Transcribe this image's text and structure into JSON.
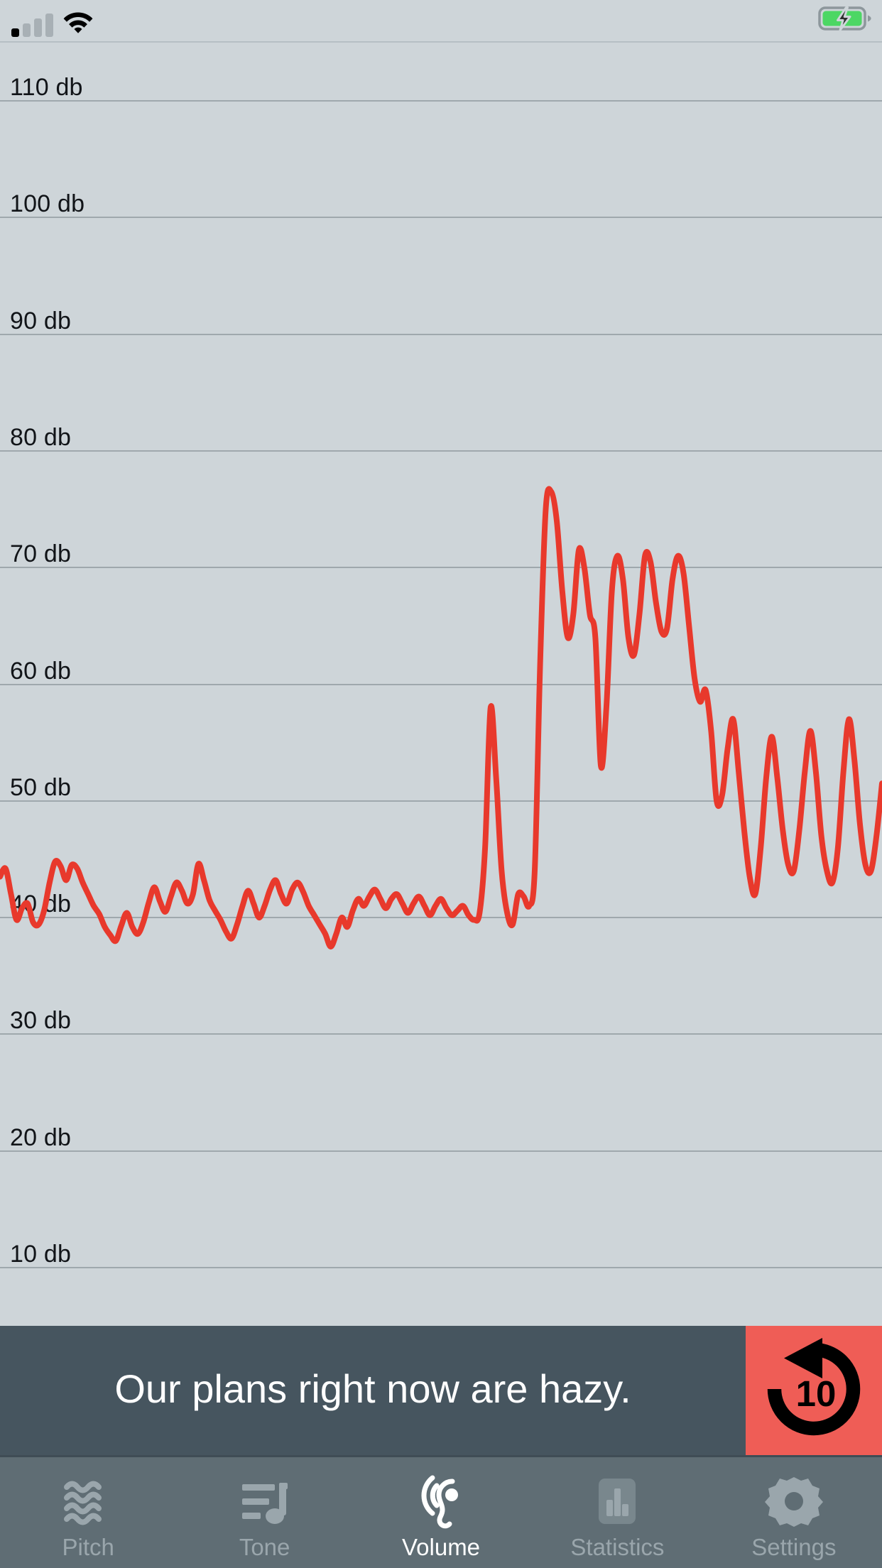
{
  "status_bar": {
    "signal_icon": "cellular-signal-icon",
    "signal_bars_filled": 1,
    "signal_bars_total": 4,
    "wifi_icon": "wifi-icon",
    "battery_icon": "battery-charging-icon",
    "battery_state": "charging"
  },
  "colors": {
    "background": "#ced5d9",
    "gridline": "#9fa8ad",
    "plot_line": "#e8392c",
    "caption_bar": "#46555f",
    "rewind_button": "#ef5d56",
    "tab_bar": "#5f6d74",
    "tab_inactive": "#9aa6ac",
    "tab_active": "#ffffff"
  },
  "chart_data": {
    "type": "line",
    "title": "",
    "xlabel": "",
    "ylabel": "",
    "unit": "db",
    "grid": true,
    "legend": "none",
    "ylim": [
      5,
      115
    ],
    "yticks": [
      110,
      100,
      90,
      80,
      70,
      60,
      50,
      40,
      30,
      20,
      10
    ],
    "ytick_labels": [
      "110 db",
      "100 db",
      "90 db",
      "80 db",
      "70 db",
      "60 db",
      "50 db",
      "40 db",
      "30 db",
      "20 db",
      "10 db"
    ],
    "xlim": [
      0,
      200
    ],
    "xticks": [],
    "xtick_labels": [],
    "series": [
      {
        "name": "Volume",
        "color": "#e8392c",
        "values": [
          43.5,
          44.2,
          42.0,
          39.8,
          40.8,
          41.2,
          39.6,
          39.4,
          40.6,
          43.0,
          44.8,
          44.4,
          43.2,
          44.5,
          44.2,
          43.0,
          42.0,
          41.0,
          40.3,
          39.2,
          38.5,
          38.0,
          39.3,
          40.4,
          39.2,
          38.6,
          39.6,
          41.3,
          42.6,
          41.4,
          40.5,
          41.8,
          43.0,
          42.3,
          41.2,
          42.0,
          44.6,
          43.2,
          41.5,
          40.6,
          39.8,
          38.8,
          38.2,
          39.4,
          41.0,
          42.3,
          41.2,
          40.0,
          41.0,
          42.4,
          43.2,
          42.0,
          41.2,
          42.4,
          43.0,
          42.2,
          41.0,
          40.2,
          39.4,
          38.6,
          37.5,
          38.6,
          40.0,
          39.2,
          40.6,
          41.6,
          41.0,
          41.8,
          42.4,
          41.6,
          40.8,
          41.6,
          42.0,
          41.2,
          40.4,
          41.2,
          41.8,
          41.0,
          40.2,
          41.0,
          41.6,
          40.8,
          40.2,
          40.6,
          41.0,
          40.2,
          39.8,
          40.4,
          46.0,
          58.0,
          52.0,
          44.0,
          40.4,
          39.4,
          42.0,
          41.8,
          41.0,
          44.0,
          62.0,
          75.0,
          76.5,
          74.0,
          68.0,
          64.0,
          66.0,
          71.5,
          70.0,
          66.0,
          64.0,
          53.0,
          58.0,
          68.0,
          71.0,
          69.0,
          64.0,
          62.5,
          66.0,
          71.0,
          70.5,
          67.0,
          64.5,
          64.8,
          69.0,
          71.0,
          69.5,
          65.0,
          60.5,
          58.5,
          59.5,
          56.0,
          50.0,
          50.5,
          54.5,
          57.0,
          52.5,
          47.5,
          43.5,
          42.0,
          46.0,
          52.0,
          55.5,
          52.0,
          47.5,
          44.5,
          44.0,
          47.5,
          52.5,
          56.0,
          52.5,
          47.0,
          44.0,
          43.0,
          46.0,
          52.5,
          57.0,
          53.5,
          48.0,
          44.5,
          44.0,
          47.0,
          51.5
        ]
      }
    ]
  },
  "caption": {
    "text": "Our plans right now are hazy."
  },
  "rewind_button": {
    "icon": "rewind-10-icon",
    "seconds": "10",
    "label": "10"
  },
  "tab_bar": {
    "active_index": 2,
    "items": [
      {
        "label": "Pitch",
        "icon": "waves-icon",
        "active": false
      },
      {
        "label": "Tone",
        "icon": "music-note-lines-icon",
        "active": false
      },
      {
        "label": "Volume",
        "icon": "ear-sound-icon",
        "active": true
      },
      {
        "label": "Statistics",
        "icon": "bar-chart-icon",
        "active": false
      },
      {
        "label": "Settings",
        "icon": "gear-icon",
        "active": false
      }
    ]
  }
}
